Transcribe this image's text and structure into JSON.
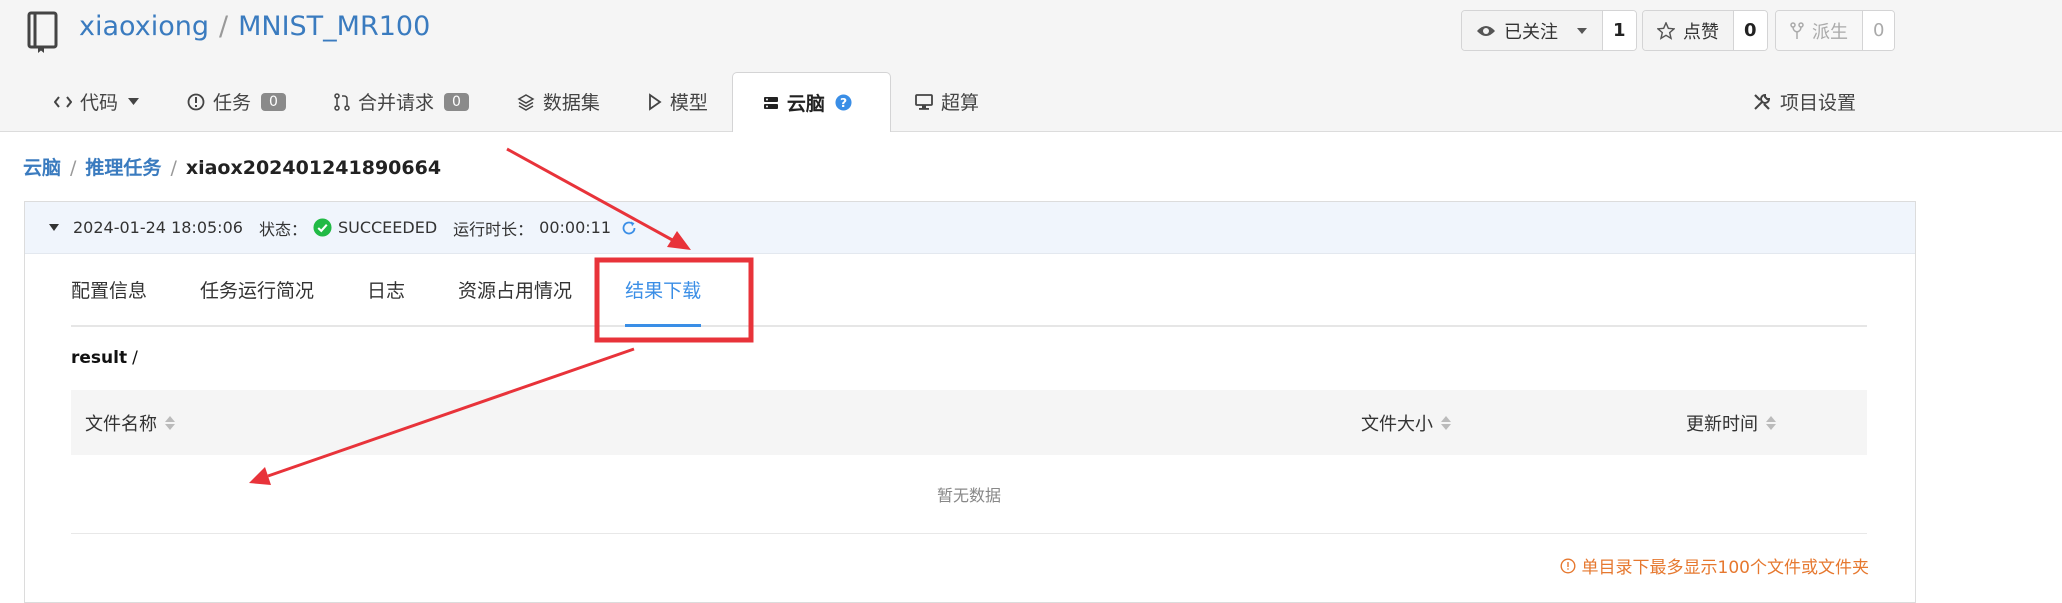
{
  "repo": {
    "owner": "xiaoxiong",
    "separator": "/",
    "name": "MNIST_MR100"
  },
  "actions": {
    "watch_label": "已关注",
    "watch_count": "1",
    "star_label": "点赞",
    "star_count": "0",
    "fork_label": "派生",
    "fork_count": "0"
  },
  "tabs": [
    {
      "label": "代码"
    },
    {
      "label": "任务",
      "badge": "0"
    },
    {
      "label": "合并请求",
      "badge": "0"
    },
    {
      "label": "数据集"
    },
    {
      "label": "模型"
    },
    {
      "label": "云脑"
    },
    {
      "label": "超算"
    }
  ],
  "settings_label": "项目设置",
  "breadcrumb": {
    "root": "云脑",
    "parent": "推理任务",
    "current": "xiaox202401241890664",
    "divider": "/"
  },
  "job": {
    "datetime": "2024-01-24 18:05:06",
    "status_label": "状态：",
    "status": "SUCCEEDED",
    "runtime_label": "运行时长：",
    "runtime": "00:00:11"
  },
  "detail_tabs": [
    "配置信息",
    "任务运行简况",
    "日志",
    "资源占用情况",
    "结果下载"
  ],
  "path": {
    "dir": "result",
    "slash": "/"
  },
  "table": {
    "columns": [
      "文件名称",
      "文件大小",
      "更新时间"
    ],
    "empty_text": "暂无数据"
  },
  "limit_note": "单目录下最多显示100个文件或文件夹",
  "colors": {
    "link": "#3a7bbf",
    "active_tab": "#3a8ee6",
    "success": "#21ba45",
    "warning": "#e6782f",
    "annotation": "#e8333a"
  }
}
